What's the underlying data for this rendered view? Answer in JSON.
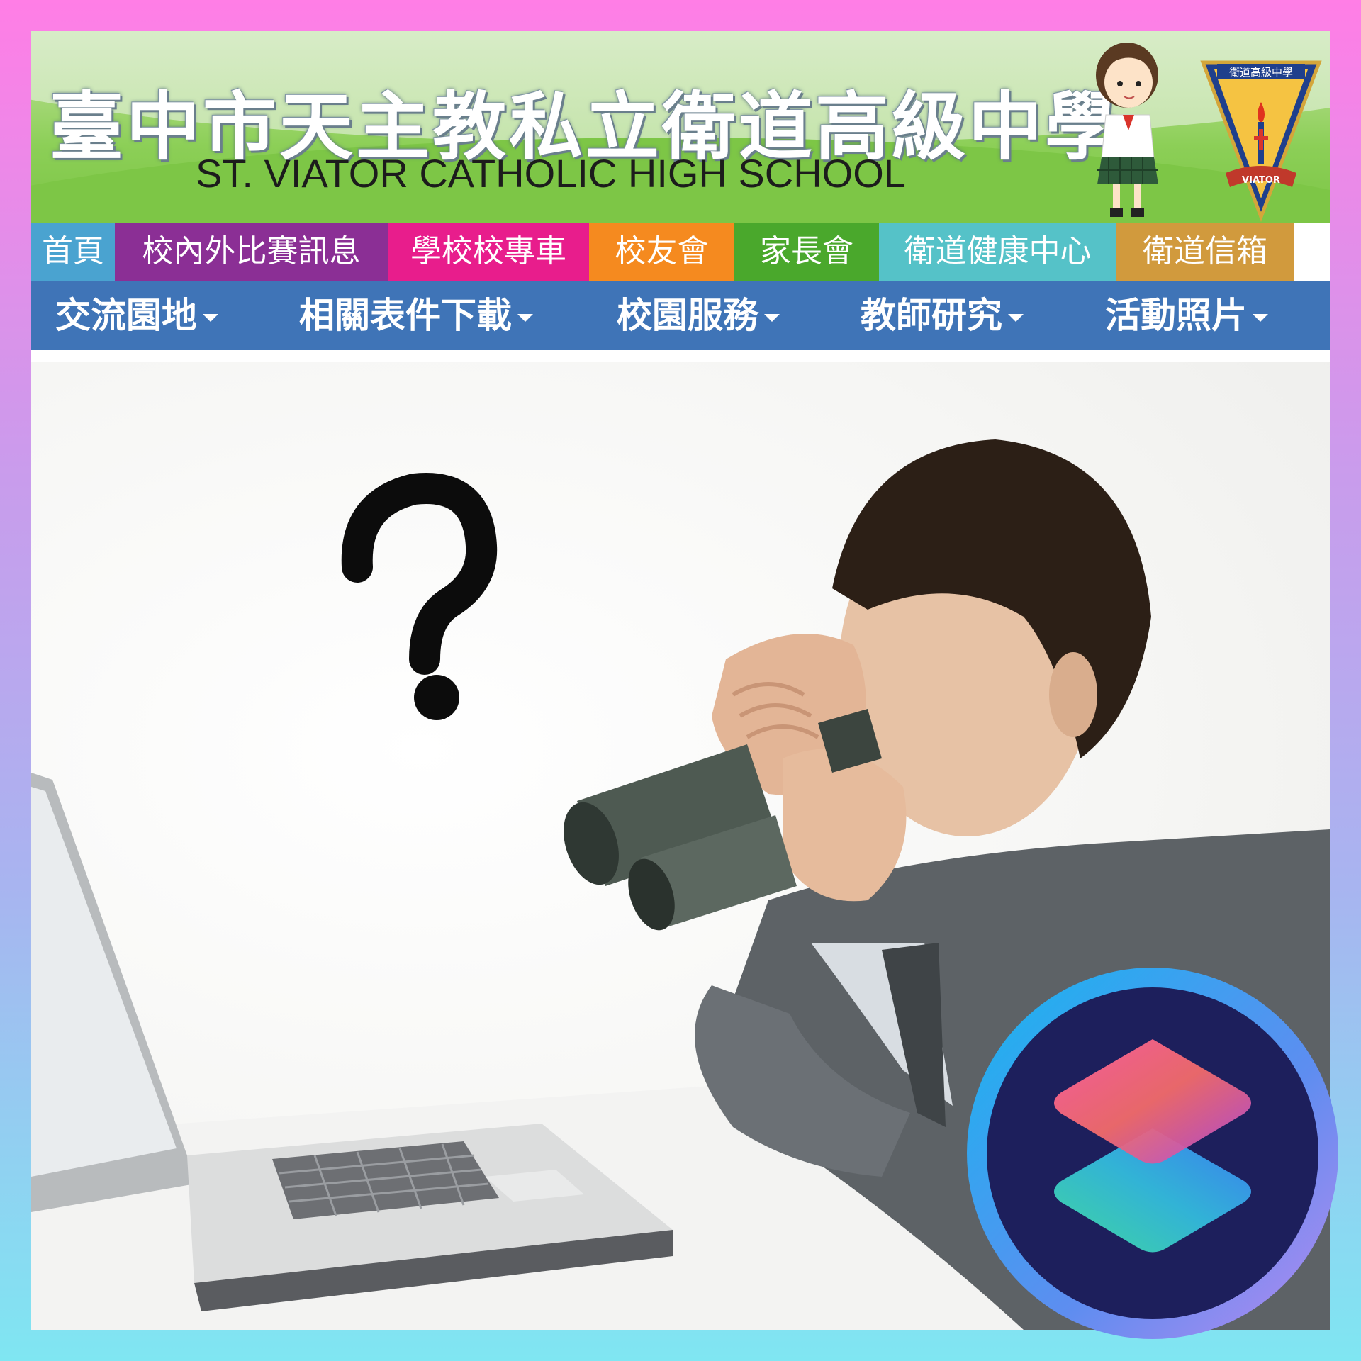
{
  "banner": {
    "school_name_cn": "臺中市天主教私立衛道高級中學",
    "school_name_en": "ST. VIATOR CATHOLIC HIGH SCHOOL",
    "crest_text": "衛道高級中學",
    "crest_banner_text": "VIATOR"
  },
  "tabs": [
    {
      "label": "首頁",
      "color": "#4aa3d0"
    },
    {
      "label": "校內外比賽訊息",
      "color": "#8b2f95"
    },
    {
      "label": "學校校專車",
      "color": "#e81d8c"
    },
    {
      "label": "校友會",
      "color": "#f58a1f"
    },
    {
      "label": "家長會",
      "color": "#4aa82c"
    },
    {
      "label": "衛道健康中心",
      "color": "#55c2c8"
    },
    {
      "label": "衛道信箱",
      "color": "#d19a3d"
    }
  ],
  "nav": [
    {
      "label": "交流園地"
    },
    {
      "label": "相關表件下載"
    },
    {
      "label": "校園服務"
    },
    {
      "label": "教師研究"
    },
    {
      "label": "活動照片"
    }
  ],
  "photo": {
    "question_mark": "?"
  },
  "colors": {
    "nav_bg": "#3f74b7",
    "border_top": "#ff7ee6",
    "border_bottom": "#7fe6f2",
    "badge_ring": "#1aa8e8",
    "badge_bg": "#1d1f5c"
  },
  "icons": [
    "caret-down-icon",
    "shortcuts-app-icon",
    "school-crest-icon",
    "student-mascot-icon",
    "question-mark-icon"
  ]
}
